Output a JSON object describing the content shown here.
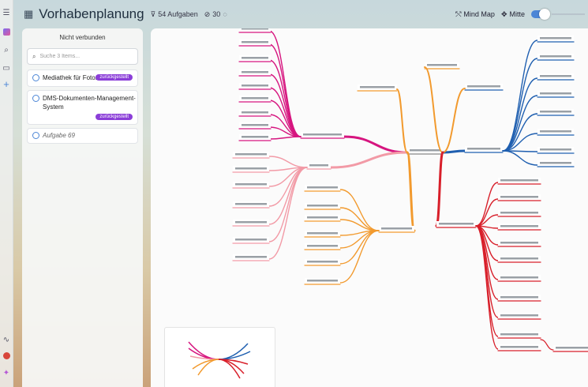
{
  "header": {
    "title": "Vorhabenplanung",
    "tasks_count": "54 Aufgaben",
    "links_count": "30",
    "view_label": "Mind Map",
    "center_label": "Mitte"
  },
  "panel": {
    "title": "Nicht verbunden",
    "search_placeholder": "Suche 3 Items...",
    "items": [
      {
        "label": "Mediathek für Fotos",
        "badge": "zurückgestellt"
      },
      {
        "label": "DMS-Dokumenten-Management-System",
        "badge": "zurückgestellt"
      },
      {
        "label": "Aufgabe 69",
        "badge": ""
      }
    ]
  },
  "colors": {
    "accent": "#4c86d6",
    "badge": "#8b3ed8",
    "branch_magenta": "#d6157f",
    "branch_pink": "#f29aa6",
    "branch_orange": "#f29a2e",
    "branch_blue": "#1f5fb0",
    "branch_red": "#d81f2a"
  },
  "icons": [
    "menu-icon",
    "app-icon",
    "search-icon",
    "folder-icon",
    "plus-icon",
    "calendar-icon",
    "filter-icon",
    "link-icon",
    "comment-icon",
    "mindmap-icon",
    "center-icon",
    "activity-icon",
    "avatar-icon",
    "sparkle-icon"
  ]
}
